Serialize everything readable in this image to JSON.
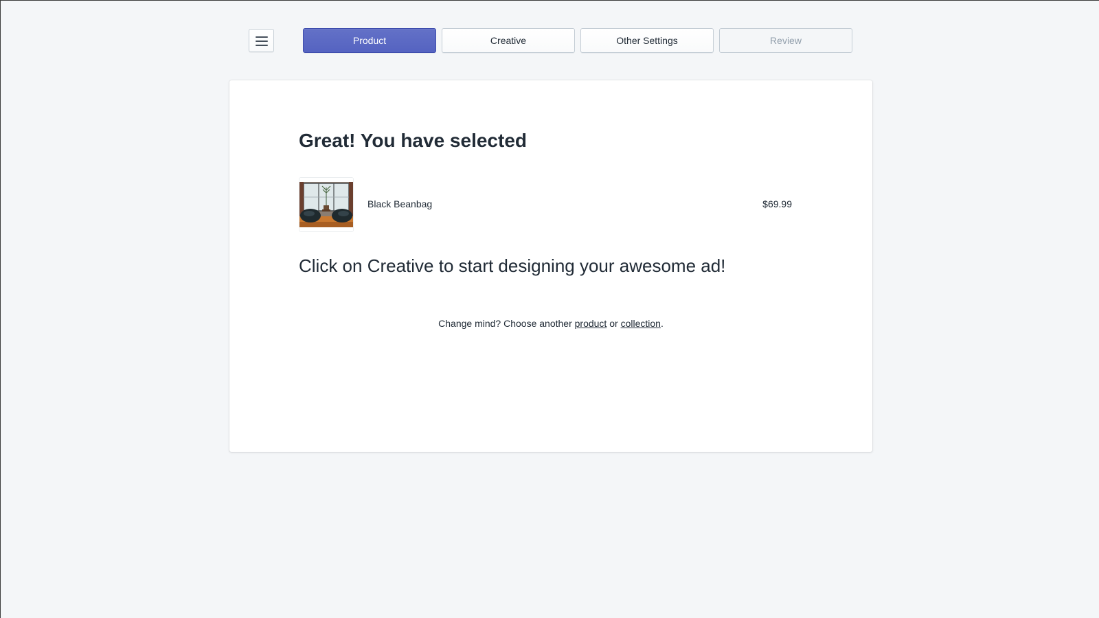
{
  "nav": {
    "menu_icon": "hamburger-menu-icon",
    "steps": [
      {
        "label": "Product",
        "state": "active"
      },
      {
        "label": "Creative",
        "state": "default"
      },
      {
        "label": "Other Settings",
        "state": "default"
      },
      {
        "label": "Review",
        "state": "disabled"
      }
    ]
  },
  "card": {
    "heading": "Great! You have selected",
    "product": {
      "name": "Black Beanbag",
      "price": "$69.99",
      "image": "product-thumbnail-beanbags-room"
    },
    "cta": "Click on Creative to start designing your awesome ad!",
    "change_mind": {
      "prefix": "Change mind? Choose another ",
      "product_link": "product",
      "middle": " or ",
      "collection_link": "collection",
      "suffix": "."
    }
  },
  "colors": {
    "page_background": "#f4f6f8",
    "accent": "#5c6ac4",
    "text": "#212b36",
    "disabled_text": "#919eab"
  }
}
